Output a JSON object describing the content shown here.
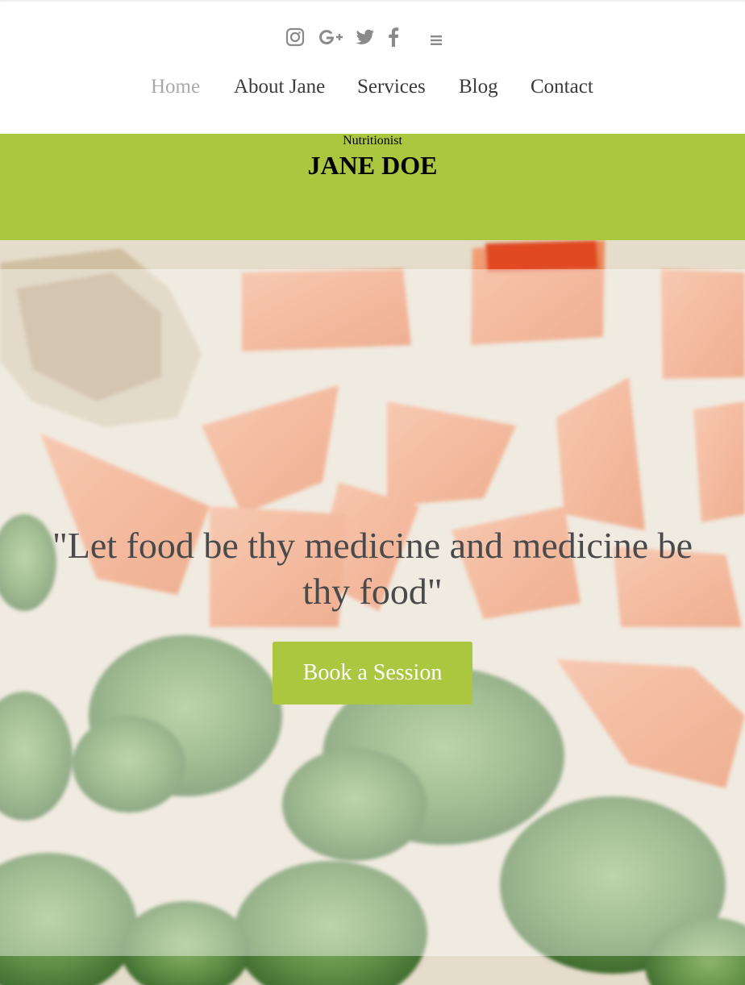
{
  "social": {
    "icons": [
      "instagram-icon",
      "google-plus-icon",
      "twitter-icon",
      "facebook-icon",
      "menu-icon"
    ],
    "icon_color": "#8a8a8a"
  },
  "nav": {
    "items": [
      {
        "label": "Home",
        "active": true
      },
      {
        "label": "About Jane"
      },
      {
        "label": "Services"
      },
      {
        "label": "Blog"
      },
      {
        "label": "Contact"
      }
    ],
    "active_color": "#a9a9a9",
    "text_color": "#3b3b3b"
  },
  "banner": {
    "name": "JANE DOE",
    "role": "Nutritionist",
    "background": "#abc63f"
  },
  "hero": {
    "quote": "\"Let food be thy medicine and medicine be thy food\"",
    "button_label": "Book a Session",
    "button_color": "#abc63f"
  }
}
